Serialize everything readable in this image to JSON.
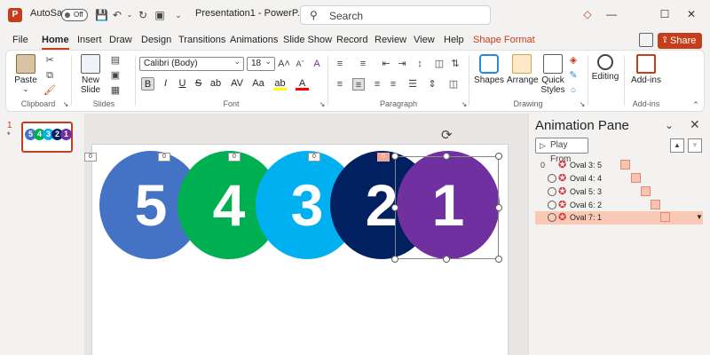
{
  "titlebar": {
    "autosave_label": "AutoSave",
    "autosave_state": "Off",
    "doc_title": "Presentation1  -  PowerP...",
    "search_placeholder": "Search"
  },
  "tabs": [
    {
      "label": "File"
    },
    {
      "label": "Home"
    },
    {
      "label": "Insert"
    },
    {
      "label": "Draw"
    },
    {
      "label": "Design"
    },
    {
      "label": "Transitions"
    },
    {
      "label": "Animations"
    },
    {
      "label": "Slide Show"
    },
    {
      "label": "Record"
    },
    {
      "label": "Review"
    },
    {
      "label": "View"
    },
    {
      "label": "Help"
    },
    {
      "label": "Shape Format"
    }
  ],
  "share_label": "Share",
  "ribbon": {
    "clipboard": {
      "paste_label": "Paste",
      "group_label": "Clipboard"
    },
    "slides": {
      "new_slide_label": "New",
      "new_slide_label2": "Slide",
      "group_label": "Slides"
    },
    "font": {
      "font_name": "Calibri (Body)",
      "font_size": "18",
      "group_label": "Font",
      "bold": "B",
      "italic": "I",
      "underline": "U",
      "strike": "S",
      "shadow": "ab",
      "spacing": "AV",
      "case": "Aa",
      "highlight": "ab",
      "color": "A",
      "grow": "A^",
      "shrink": "Aˇ"
    },
    "paragraph": {
      "group_label": "Paragraph"
    },
    "drawing": {
      "shapes_label": "Shapes",
      "arrange_label": "Arrange",
      "quick_styles_label": "Quick",
      "quick_styles_label2": "Styles",
      "group_label": "Drawing"
    },
    "editing": {
      "label": "Editing"
    },
    "addins": {
      "label": "Add-ins",
      "group_label": "Add-ins"
    }
  },
  "thumbnail": {
    "number": "1",
    "star": "*",
    "circles": [
      "5",
      "4",
      "3",
      "2",
      "1"
    ]
  },
  "slide": {
    "circles": [
      {
        "number": "5",
        "color": "#4472c4",
        "tag": "0"
      },
      {
        "number": "4",
        "color": "#00b050",
        "tag": "0"
      },
      {
        "number": "3",
        "color": "#00b0f0",
        "tag": "0"
      },
      {
        "number": "2",
        "color": "#002060",
        "tag": "0"
      },
      {
        "number": "1",
        "color": "#7030a0",
        "tag": ""
      }
    ],
    "left_tag": "0"
  },
  "animation_pane": {
    "title": "Animation Pane",
    "play_from": "Play From",
    "items": [
      {
        "index": "0",
        "label": "Oval 3: 5",
        "has_clock": false
      },
      {
        "index": "",
        "label": "Oval 4: 4",
        "has_clock": true
      },
      {
        "index": "",
        "label": "Oval 5: 3",
        "has_clock": true
      },
      {
        "index": "",
        "label": "Oval 6: 2",
        "has_clock": true
      },
      {
        "index": "",
        "label": "Oval 7: 1",
        "has_clock": true,
        "selected": true
      }
    ]
  }
}
